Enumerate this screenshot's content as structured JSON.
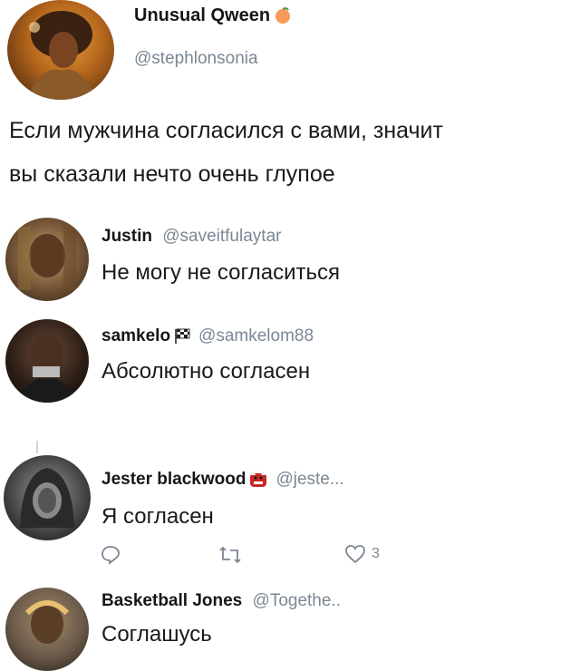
{
  "main_tweet": {
    "display_name": "Unusual Qween",
    "name_emoji": "peach-emoji",
    "handle": "@stephlonsonia",
    "text_line1": "Если мужчина согласился с вами, значит",
    "text_line2": "вы сказали нечто очень глупое"
  },
  "replies": [
    {
      "display_name": "Justin",
      "handle": "@saveitfulaytar",
      "text": "Не могу не согласиться"
    },
    {
      "display_name": "samkelo",
      "name_emoji": "checkered-flag-emoji",
      "handle": "@samkelom88",
      "text": "Абсолютно согласен"
    },
    {
      "display_name": "Jester blackwood",
      "name_emoji": "ogre-emoji",
      "handle": "@jeste...",
      "text": "Я согласен",
      "actions": {
        "reply_icon": "reply-icon",
        "retweet_icon": "retweet-icon",
        "like_icon": "heart-icon",
        "like_count": "3"
      }
    },
    {
      "display_name": "Basketball Jones",
      "handle": "@Togethe..",
      "text": "Соглашусь"
    }
  ],
  "colors": {
    "handle": "#7b8794",
    "text": "#14171a",
    "connector": "#d0d6dc"
  }
}
